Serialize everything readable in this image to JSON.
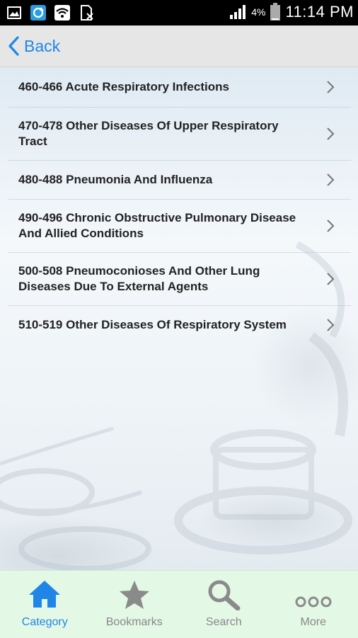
{
  "status_bar": {
    "battery_percent": "4%",
    "time": "11:14 PM"
  },
  "header": {
    "back_label": "Back"
  },
  "list": {
    "items": [
      {
        "label_line1": "460-466 Acute Respiratory Infections",
        "label_line2": ""
      },
      {
        "label_line1": "470-478 Other Diseases Of Upper Respiratory",
        "label_line2": "Tract"
      },
      {
        "label_line1": "480-488 Pneumonia And Influenza",
        "label_line2": ""
      },
      {
        "label_line1": "490-496 Chronic Obstructive Pulmonary Disease",
        "label_line2": "And Allied Conditions"
      },
      {
        "label_line1": "500-508 Pneumoconioses And Other Lung",
        "label_line2": "Diseases Due To External Agents"
      },
      {
        "label_line1": "510-519 Other Diseases Of Respiratory System",
        "label_line2": ""
      }
    ]
  },
  "bottom_nav": {
    "tabs": [
      {
        "label": "Category",
        "icon": "home-icon",
        "active": true
      },
      {
        "label": "Bookmarks",
        "icon": "star-icon",
        "active": false
      },
      {
        "label": "Search",
        "icon": "search-icon",
        "active": false
      },
      {
        "label": "More",
        "icon": "more-icon",
        "active": false
      }
    ]
  },
  "colors": {
    "accent": "#1f86e8",
    "header_bg": "#e6e6e6",
    "nav_bg": "#e4f8e6",
    "inactive": "#888888"
  }
}
